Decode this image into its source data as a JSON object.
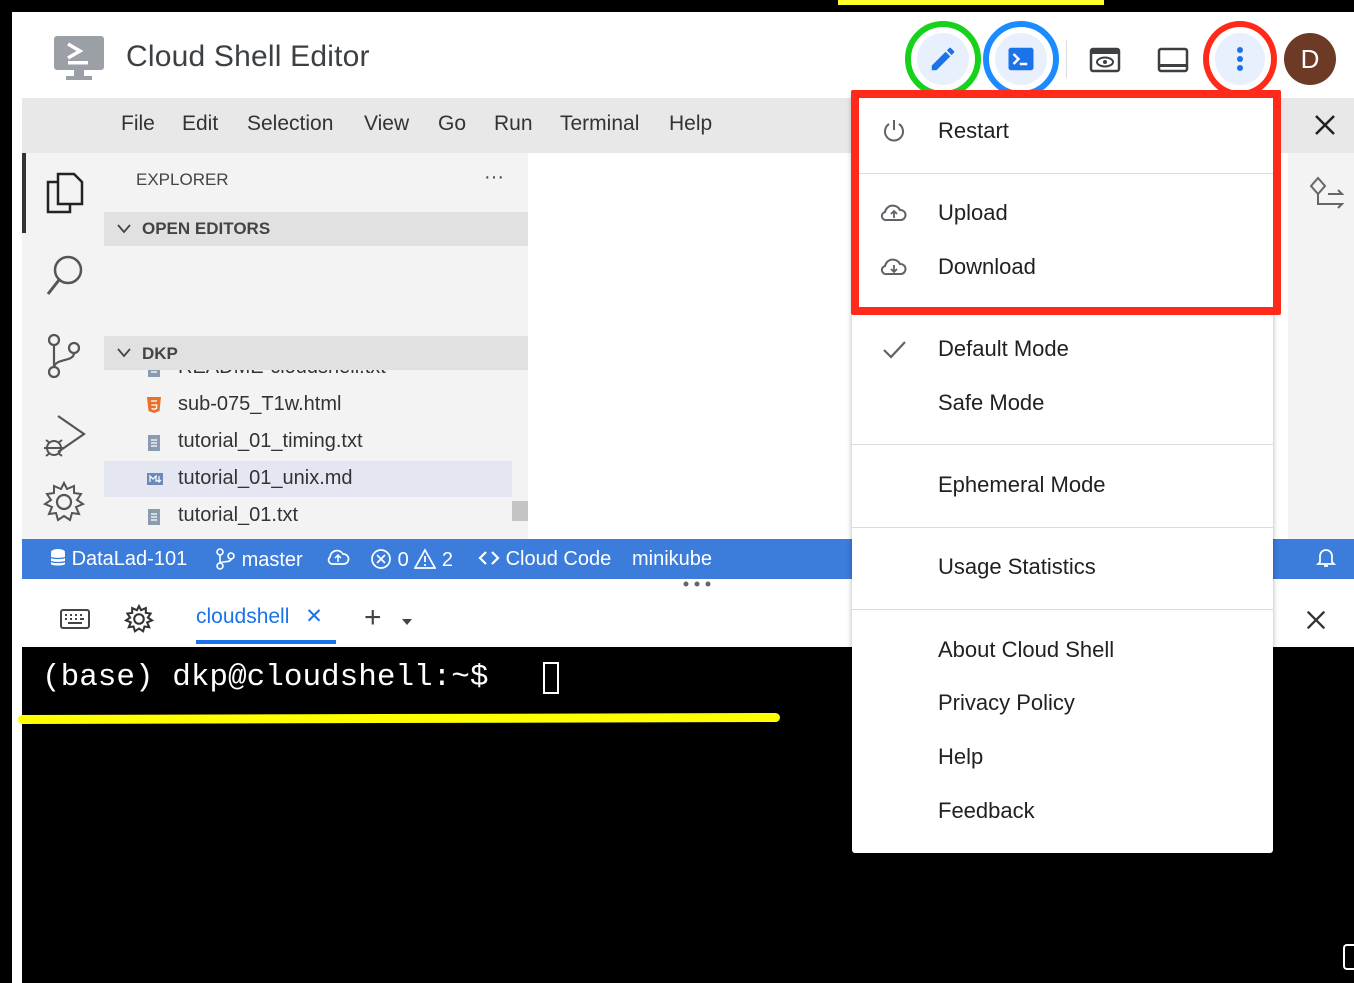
{
  "header": {
    "title": "Cloud Shell Editor",
    "avatar_letter": "D"
  },
  "menubar": {
    "items": [
      "File",
      "Edit",
      "Selection",
      "View",
      "Go",
      "Run",
      "Terminal",
      "Help"
    ]
  },
  "explorer": {
    "title": "EXPLORER",
    "more": "···",
    "open_editors": "OPEN EDITORS",
    "folder": "DKP",
    "files": [
      {
        "name": "README-cloudshell.txt",
        "icon": "text-file-icon"
      },
      {
        "name": "sub-075_T1w.html",
        "icon": "html5-icon"
      },
      {
        "name": "tutorial_01_timing.txt",
        "icon": "text-file-icon"
      },
      {
        "name": "tutorial_01_unix.md",
        "icon": "markdown-icon"
      },
      {
        "name": "tutorial_01.txt",
        "icon": "text-file-icon"
      }
    ]
  },
  "statusbar": {
    "repo": "DataLad-101",
    "branch": "master",
    "errors": "0",
    "warnings": "2",
    "cloud_code": "Cloud Code",
    "cluster": "minikube"
  },
  "panel": {
    "tab_label": "cloudshell",
    "close_glyph": "✕",
    "add_glyph": "+"
  },
  "terminal": {
    "prompt": "(base) dkp@cloudshell:~$ "
  },
  "dropdown": {
    "restart": "Restart",
    "upload": "Upload",
    "download": "Download",
    "default_mode": "Default Mode",
    "safe_mode": "Safe Mode",
    "ephemeral_mode": "Ephemeral Mode",
    "usage_statistics": "Usage Statistics",
    "about": "About Cloud Shell",
    "privacy": "Privacy Policy",
    "help": "Help",
    "feedback": "Feedback"
  },
  "colors": {
    "accent_blue": "#3c7ddb",
    "annotation_green": "#16d21a",
    "annotation_blue": "#1a8cff",
    "annotation_red": "#ff2a1a",
    "annotation_yellow": "#ffff00",
    "avatar_brown": "#6d3a26"
  }
}
